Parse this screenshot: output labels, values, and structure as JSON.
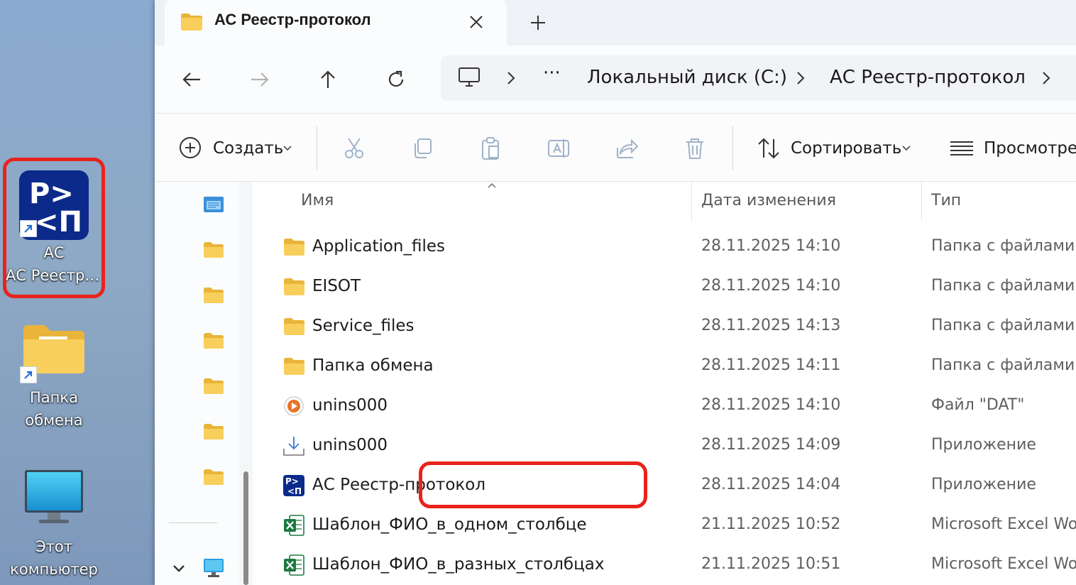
{
  "desktop": {
    "icons": [
      {
        "label": "АС Реестр-пр..."
      },
      {
        "label_line1": "Папка",
        "label_line2": "обмена"
      },
      {
        "label_line1": "Этот",
        "label_line2": "компьютер"
      }
    ],
    "app_icon_glyphs": {
      "top": "P>",
      "bottom": "<П"
    }
  },
  "explorer": {
    "tab": {
      "title": "АС Реестр-протокол"
    },
    "breadcrumbs": [
      "Локальный диск (C:)",
      "АС Реестр-протокол"
    ],
    "breadcrumb_more": "···",
    "toolbar": {
      "create": "Создать",
      "sort": "Сортировать",
      "view": "Просмотреть"
    },
    "columns": {
      "name": "Имя",
      "date": "Дата изменения",
      "type": "Тип"
    },
    "files": [
      {
        "name": "Application_files",
        "date": "28.11.2025 14:10",
        "type": "Папка с файлами",
        "icon": "folder-icon"
      },
      {
        "name": "EISOT",
        "date": "28.11.2025 14:10",
        "type": "Папка с файлами",
        "icon": "folder-icon"
      },
      {
        "name": "Service_files",
        "date": "28.11.2025 14:13",
        "type": "Папка с файлами",
        "icon": "folder-icon"
      },
      {
        "name": "Папка обмена",
        "date": "28.11.2025 14:11",
        "type": "Папка с файлами",
        "icon": "folder-icon"
      },
      {
        "name": "unins000",
        "date": "28.11.2025 14:10",
        "type": "Файл \"DAT\"",
        "icon": "dat-file-icon"
      },
      {
        "name": "unins000",
        "date": "28.11.2025 14:09",
        "type": "Приложение",
        "icon": "installer-icon"
      },
      {
        "name": "АС Реестр-протокол",
        "date": "28.11.2025 14:04",
        "type": "Приложение",
        "icon": "app-icon"
      },
      {
        "name": "Шаблон_ФИО_в_одном_столбце",
        "date": "21.11.2025 10:52",
        "type": "Microsoft Excel Wo",
        "icon": "excel-icon"
      },
      {
        "name": "Шаблон_ФИО_в_разных_столбцах",
        "date": "21.11.2025 10:51",
        "type": "Microsoft Excel Wo",
        "icon": "excel-icon"
      }
    ]
  },
  "colors": {
    "highlight": "#e8231c",
    "app_blue": "#0b2a8a",
    "folder": "#f5c84a",
    "excel": "#1d7a42"
  }
}
